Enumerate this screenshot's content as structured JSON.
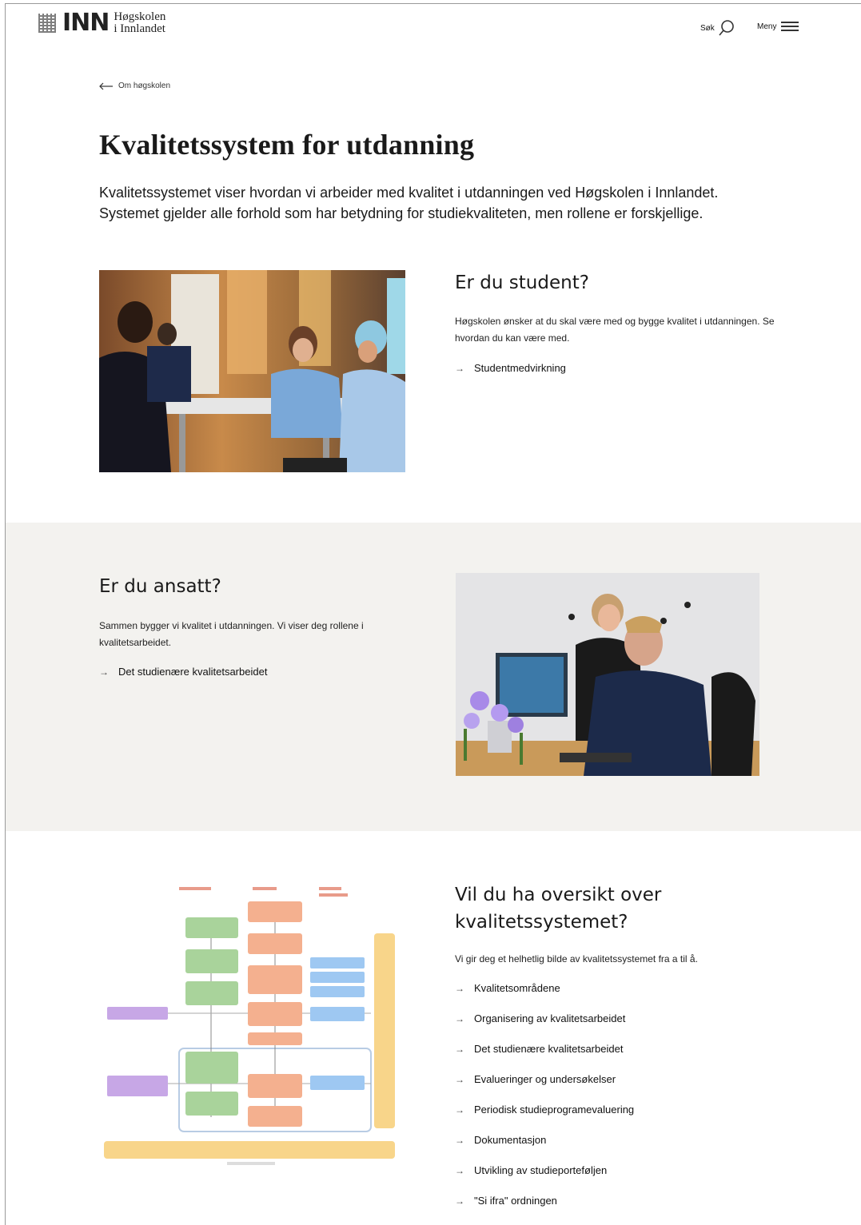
{
  "header": {
    "logo_mark": "INN",
    "logo_line1": "Høgskolen",
    "logo_line2": "i Innlandet",
    "search_label": "Søk",
    "menu_label": "Meny"
  },
  "breadcrumb": {
    "back_label": "Om høgskolen"
  },
  "page": {
    "title": "Kvalitetssystem for utdanning",
    "intro": "Kvalitetssystemet viser hvordan vi arbeider med kvalitet i utdanningen ved Høgskolen i Innlandet. Systemet gjelder alle forhold som har betydning for studiekvaliteten, men rollene er forskjellige."
  },
  "student": {
    "heading": "Er du student?",
    "text": "Høgskolen ønsker at du skal være med og bygge kvalitet i utdanningen. Se hvordan du kan være med.",
    "link": "Studentmedvirkning"
  },
  "employee": {
    "heading": "Er du ansatt?",
    "text": "Sammen bygger vi kvalitet i utdanningen. Vi viser deg rollene i kvalitetsarbeidet.",
    "link": "Det studienære kvalitetsarbeidet"
  },
  "overview": {
    "heading_line1": "Vil du ha oversikt over",
    "heading_line2": "kvalitetssystemet?",
    "text": "Vi gir deg et helhetlig bilde av kvalitetssystemet fra a til å.",
    "links": [
      "Kvalitetsområdene",
      "Organisering av kvalitetsarbeidet",
      "Det studienære kvalitetsarbeidet",
      "Evalueringer og undersøkelser",
      "Periodisk studieprogramevaluering",
      "Dokumentasjon",
      "Utvikling av studieporteføljen",
      "\"Si ifra\" ordningen"
    ]
  },
  "colors": {
    "band": "#f3f2ef",
    "diagram_green": "#a9d39b",
    "diagram_orange": "#f4b08f",
    "diagram_blue": "#9ec8f2",
    "diagram_purple": "#c7a7e6",
    "diagram_yellow": "#f8d58a"
  },
  "icons": [
    "arrow-left-icon",
    "search-icon",
    "menu-icon",
    "arrow-right-icon"
  ]
}
